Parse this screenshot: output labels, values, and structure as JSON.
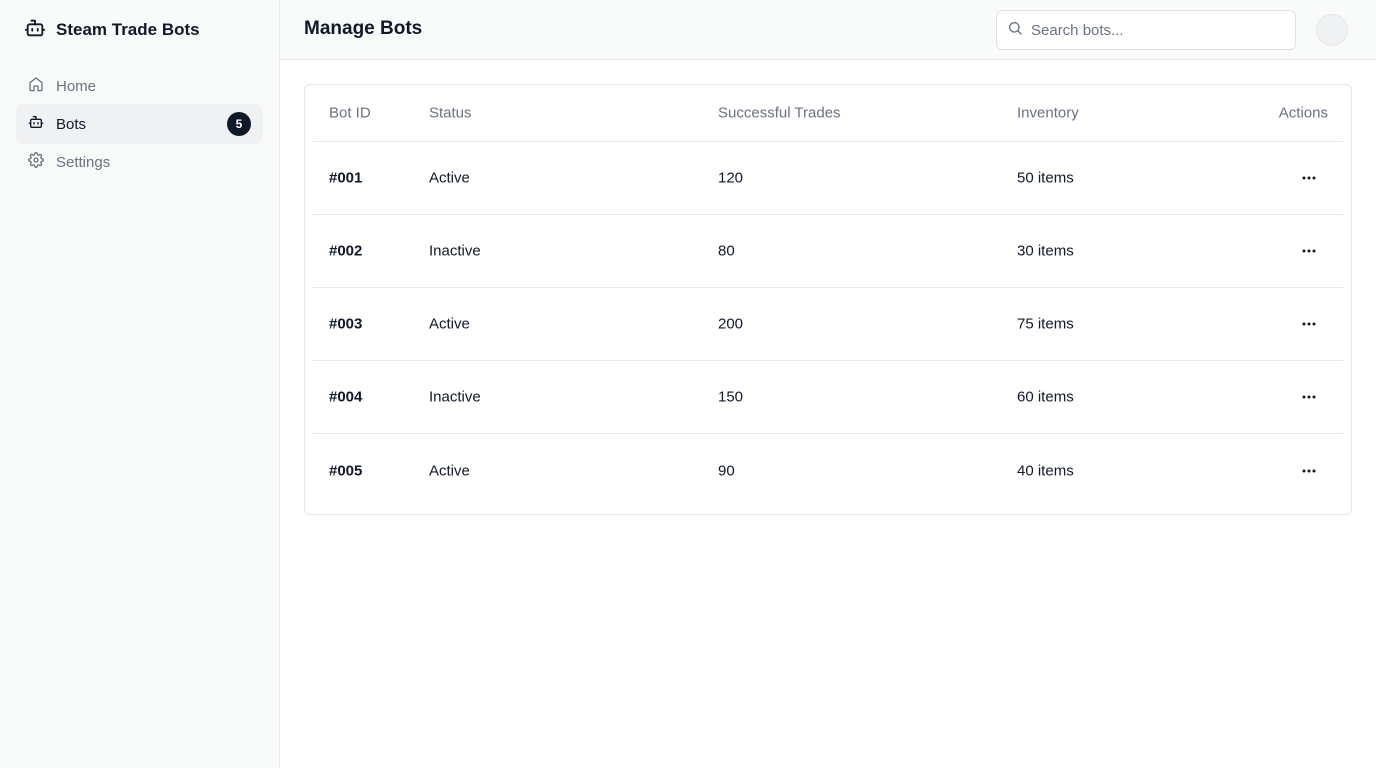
{
  "app": {
    "title": "Steam Trade Bots",
    "logo_icon": "bot-icon"
  },
  "sidebar": {
    "items": [
      {
        "label": "Home",
        "icon": "home-icon",
        "active": false
      },
      {
        "label": "Bots",
        "icon": "bot-icon",
        "active": true,
        "badge": "5"
      },
      {
        "label": "Settings",
        "icon": "gear-icon",
        "active": false
      }
    ]
  },
  "header": {
    "title": "Manage Bots",
    "search": {
      "placeholder": "Search bots...",
      "value": ""
    }
  },
  "table": {
    "columns": [
      "Bot ID",
      "Status",
      "Successful Trades",
      "Inventory",
      "Actions"
    ],
    "rows": [
      {
        "id": "#001",
        "status": "Active",
        "trades": "120",
        "inventory": "50 items"
      },
      {
        "id": "#002",
        "status": "Inactive",
        "trades": "80",
        "inventory": "30 items"
      },
      {
        "id": "#003",
        "status": "Active",
        "trades": "200",
        "inventory": "75 items"
      },
      {
        "id": "#004",
        "status": "Inactive",
        "trades": "150",
        "inventory": "60 items"
      },
      {
        "id": "#005",
        "status": "Active",
        "trades": "90",
        "inventory": "40 items"
      }
    ],
    "row_action_icon": "more-horizontal-icon"
  },
  "colors": {
    "sidebar_bg": "#f9fafa",
    "active_nav_bg": "#f0f1f2",
    "badge_bg": "#111827",
    "text_primary": "#111827",
    "text_muted": "#6b7280",
    "border": "#e5e7eb"
  }
}
